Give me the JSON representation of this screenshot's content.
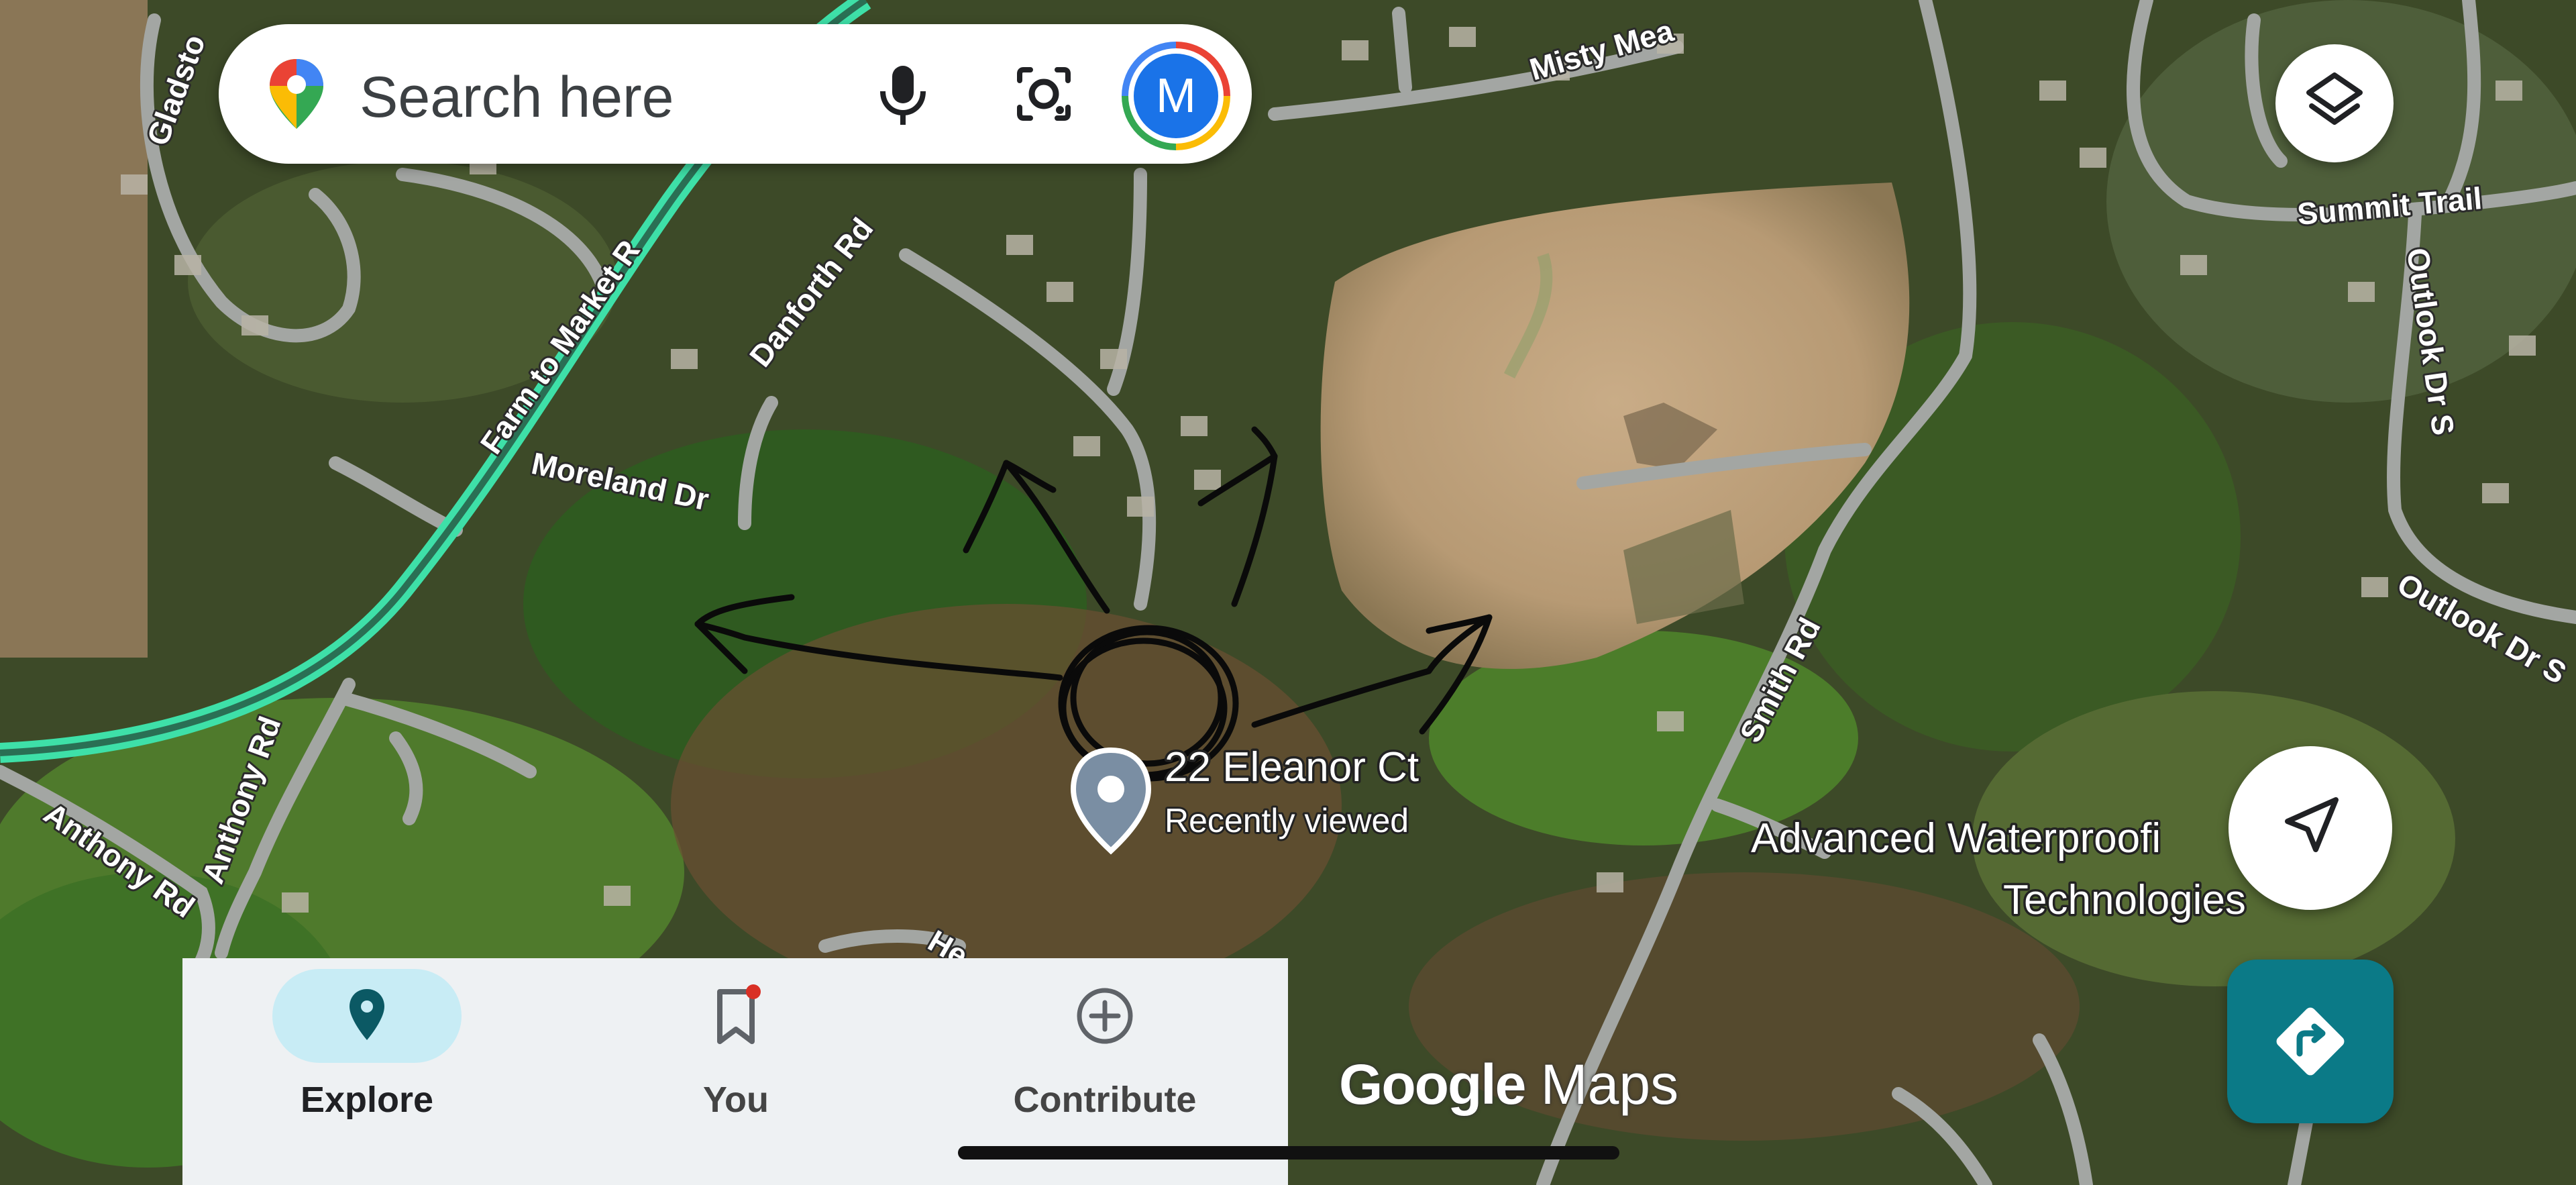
{
  "search": {
    "placeholder": "Search here",
    "avatar_letter": "M",
    "icons": [
      "maps-pin-logo",
      "mic-icon",
      "camera-lens-icon"
    ]
  },
  "map": {
    "view": "satellite",
    "road_labels": [
      "Gladsto",
      "Farm to Market R",
      "Danforth Rd",
      "Moreland Dr",
      "Misty Mea",
      "Summit Trail",
      "Outlook Dr S",
      "Outlook Dr S",
      "Smith Rd",
      "Anthony Rd",
      "Anthony Rd",
      "He"
    ],
    "place": {
      "name": "22 Eleanor Ct",
      "subtitle": "Recently viewed"
    },
    "business_label_line1": "Advanced Waterproofi",
    "business_label_line2": "Technologies"
  },
  "controls": {
    "layers": "layers-icon",
    "my_location": "navigation-arrow-icon",
    "directions": "directions-icon"
  },
  "bottom_nav": {
    "items": [
      {
        "label": "Explore",
        "icon": "location-pin-icon",
        "active": true
      },
      {
        "label": "You",
        "icon": "bookmark-icon",
        "active": false
      },
      {
        "label": "Contribute",
        "icon": "add-circle-icon",
        "active": false
      }
    ]
  },
  "attribution": {
    "google": "Google",
    "maps": "Maps"
  },
  "colors": {
    "accent_teal": "#0b7a87",
    "highway_green": "#3ee0a8",
    "nav_active_pill": "#c8ecf5",
    "notification_dot": "#d93025"
  }
}
